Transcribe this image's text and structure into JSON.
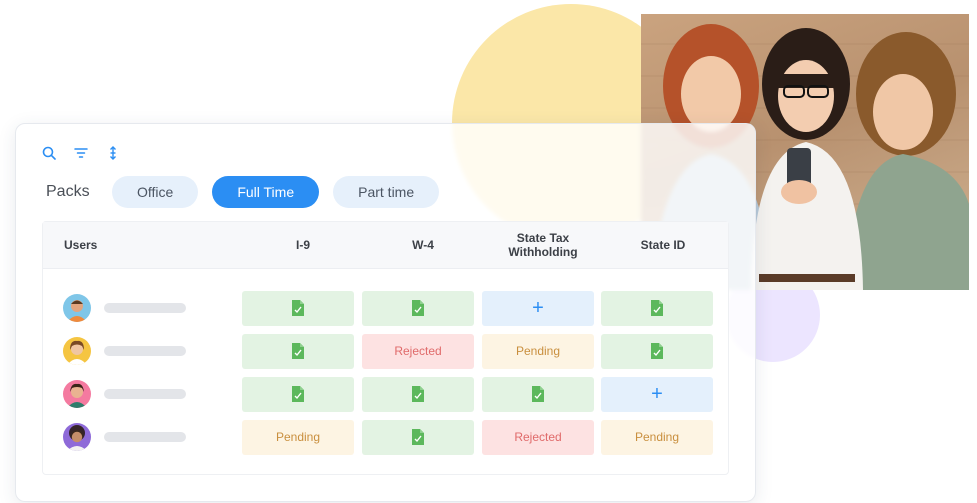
{
  "toolbar": {
    "icons": [
      "search-icon",
      "filter-icon",
      "sort-icon"
    ]
  },
  "packs": {
    "label": "Packs",
    "tabs": [
      {
        "label": "Office",
        "active": false
      },
      {
        "label": "Full Time",
        "active": true
      },
      {
        "label": "Part time",
        "active": false
      }
    ]
  },
  "table": {
    "headers": {
      "users": "Users",
      "i9": "I-9",
      "w4": "W-4",
      "state_tax": "State Tax Withholding",
      "state_id": "State ID"
    },
    "rows": [
      {
        "cells": [
          {
            "status": "done",
            "text": ""
          },
          {
            "status": "done",
            "text": ""
          },
          {
            "status": "add",
            "text": "+"
          },
          {
            "status": "done",
            "text": ""
          }
        ]
      },
      {
        "cells": [
          {
            "status": "done",
            "text": ""
          },
          {
            "status": "rejected",
            "text": "Rejected"
          },
          {
            "status": "pending",
            "text": "Pending"
          },
          {
            "status": "done",
            "text": ""
          }
        ]
      },
      {
        "cells": [
          {
            "status": "done",
            "text": ""
          },
          {
            "status": "done",
            "text": ""
          },
          {
            "status": "done",
            "text": ""
          },
          {
            "status": "add",
            "text": "+"
          }
        ]
      },
      {
        "cells": [
          {
            "status": "pending",
            "text": "Pending"
          },
          {
            "status": "done",
            "text": ""
          },
          {
            "status": "rejected",
            "text": "Rejected"
          },
          {
            "status": "pending",
            "text": "Pending"
          }
        ]
      }
    ]
  },
  "colors": {
    "accent": "#2b8ef3",
    "done_bg": "#e3f3e3",
    "doc_icon": "#5cb85c",
    "rejected_text": "#e06a6a",
    "pending_text": "#c98f3e",
    "tab_bg": "#e6f0fb"
  }
}
